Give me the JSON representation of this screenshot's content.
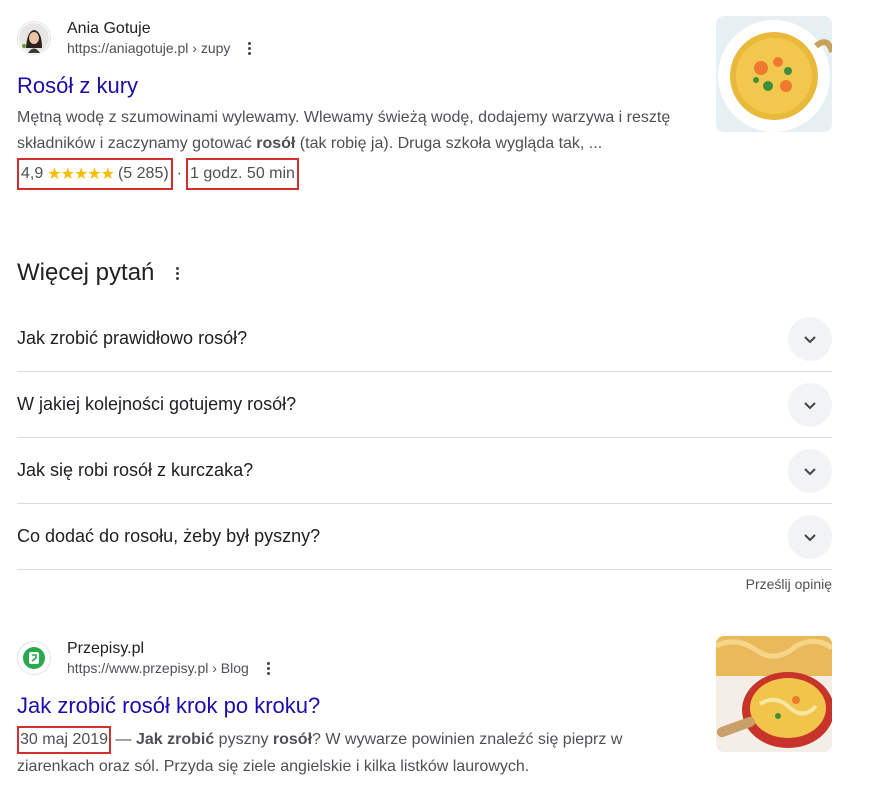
{
  "result1": {
    "site_name": "Ania Gotuje",
    "url": "https://aniagotuje.pl › zupy",
    "title": "Rosół z kury",
    "snippet_a": "Mętną wodę z szumowinami wylewamy. Wlewamy świeżą wodę, dodajemy warzywa i resztę składników i zaczynamy gotować ",
    "snippet_bold": "rosół",
    "snippet_b": " (tak robię ja). Druga szkoła wygląda tak, ...",
    "rating": "4,9",
    "stars": "★★★★★",
    "reviews": "(5 285)",
    "separator": "·",
    "time": "1 godz. 50 min",
    "thumb_icon": "soup-image"
  },
  "paa": {
    "title": "Więcej pytań",
    "questions": [
      "Jak zrobić prawidłowo rosół?",
      "W jakiej kolejności gotujemy rosół?",
      "Jak się robi rosół z kurczaka?",
      "Co dodać do rosołu, żeby był pyszny?"
    ],
    "feedback": "Prześlij opinię"
  },
  "result2": {
    "site_name": "Przepisy.pl",
    "url": "https://www.przepisy.pl › Blog",
    "title": "Jak zrobić rosół krok po kroku?",
    "date": "30 maj 2019",
    "dash": " — ",
    "bold1": "Jak zrobić",
    "text1": " pyszny ",
    "bold2": "rosół",
    "text2": "? W wywarze powinien znaleźć się pieprz w ziarenkach oraz sól. Przyda się ziele angielskie i kilka listków laurowych.",
    "thumb_icon": "noodle-soup-image"
  },
  "colors": {
    "link": "#1a0dab",
    "star": "#fbbc04",
    "highlight_box": "#d32f2f"
  }
}
